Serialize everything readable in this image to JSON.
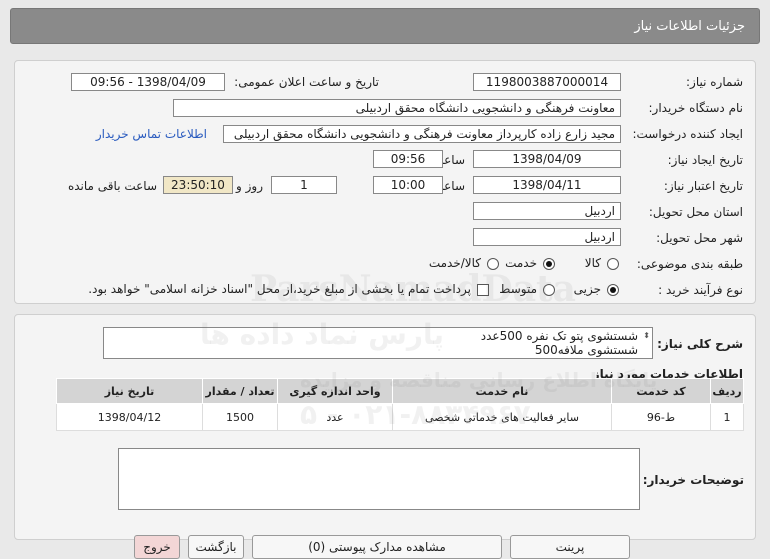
{
  "header": {
    "title": "جزئیات اطلاعات نیاز"
  },
  "form": {
    "need_number_label": "شماره نیاز:",
    "need_number": "1198003887000014",
    "announce_label": "تاریخ و ساعت اعلان عمومی:",
    "announce_value": "1398/04/09 - 09:56",
    "buyer_org_label": "نام دستگاه خریدار:",
    "buyer_org": "معاونت فرهنگی و دانشجویی دانشگاه محقق اردبیلی",
    "requester_label": "ایجاد کننده درخواست:",
    "requester": "مجید زارع زاده کارپرداز معاونت فرهنگی و دانشجویی دانشگاه محقق اردبیلی",
    "contact_link": "اطلاعات تماس خریدار",
    "created_label": "تاریخ ایجاد نیاز:",
    "created_date": "1398/04/09",
    "time_label": "ساعت",
    "created_time": "09:56",
    "valid_label": "تاریخ اعتبار نیاز:",
    "valid_date": "1398/04/11",
    "valid_time": "10:00",
    "days_value": "1",
    "days_label": "روز و",
    "countdown": "23:50:10",
    "remaining_label": "ساعت باقی مانده",
    "province_label": "استان محل تحویل:",
    "province": "اردبیل",
    "city_label": "شهر محل تحویل:",
    "city": "اردبیل",
    "category_label": "طبقه بندی موضوعی:",
    "category_options": [
      "کالا",
      "خدمت",
      "کالا/خدمت"
    ],
    "category_selected": "خدمت",
    "process_label": "نوع فرآیند خرید :",
    "process_options": [
      "جزیی",
      "متوسط"
    ],
    "process_selected": "جزیی",
    "payment_note": "پرداخت تمام یا بخشی از مبلغ خرید،از محل \"اسناد خزانه اسلامی\" خواهد بود."
  },
  "description": {
    "label": "شرح کلی نیاز:",
    "line1": "شستشوی پتو تک نفره 500عدد",
    "line2": "شستشوی ملافه500"
  },
  "services": {
    "title": "اطلاعات خدمات مورد نیاز",
    "columns": [
      "ردیف",
      "کد خدمت",
      "نام خدمت",
      "واحد اندازه گیری",
      "تعداد / مقدار",
      "تاریخ نیاز"
    ],
    "rows": [
      {
        "row": "1",
        "code": "ط-96",
        "name": "سایر فعالیت های خدماتی شخصی",
        "unit": "عدد",
        "qty": "1500",
        "date": "1398/04/12"
      }
    ]
  },
  "buyer_notes": {
    "label": "توضیحات خریدار:"
  },
  "buttons": {
    "print": "پرینت",
    "view_offers": "مشاهده مدارک پیوستی (0)",
    "back": "بازگشت",
    "exit": "خروج"
  },
  "watermark": {
    "brand": "ParsNamadData",
    "line1": "پارس نماد داده ها",
    "line2": "پایگاه اطلاع رسانی مناقصه و مزایده",
    "phone": "۰۲۱-۸۸۳۴۹۶۷۰ - ۵"
  },
  "colors": {
    "link": "#2a5bbf",
    "countdown_bg": "#f1e7c6",
    "header_bg": "#8a8a8a"
  }
}
